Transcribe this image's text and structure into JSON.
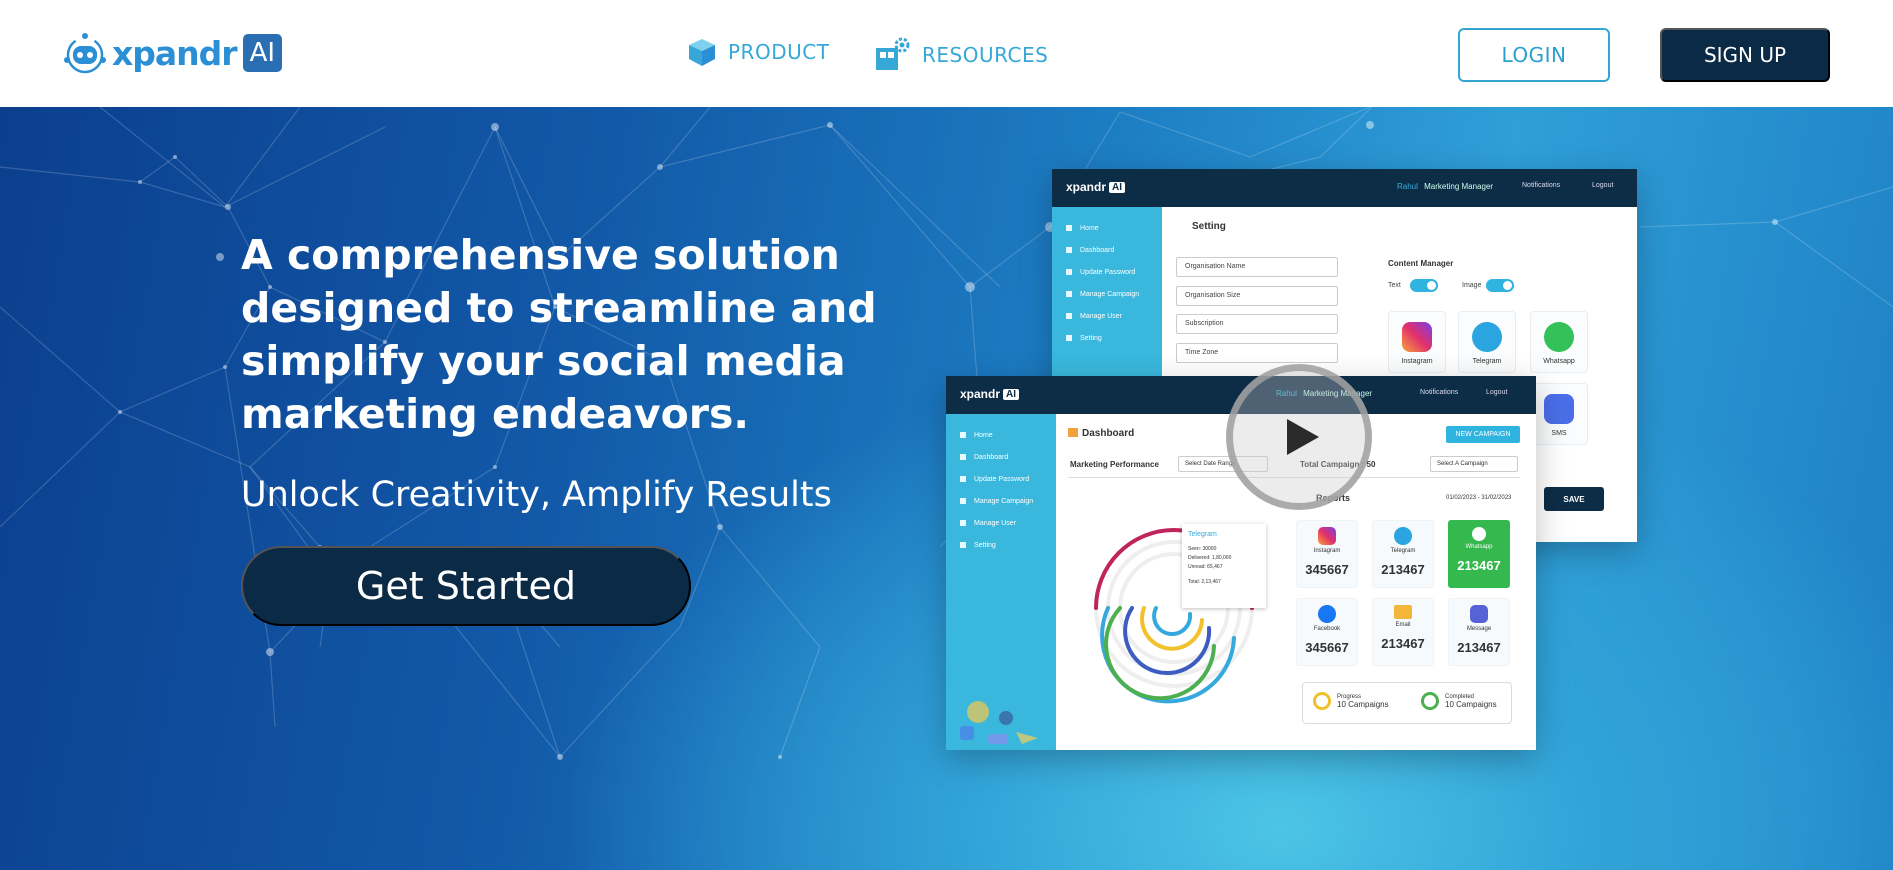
{
  "nav": {
    "brand": "xpandr",
    "brand_badge": "AI",
    "links": [
      {
        "label": "PRODUCT",
        "icon": "box-icon"
      },
      {
        "label": "RESOURCES",
        "icon": "resources-gear-icon"
      }
    ],
    "login_label": "LOGIN",
    "signup_label": "SIGN UP"
  },
  "hero": {
    "title": "A comprehensive solution designed to streamline and simplify your social media marketing endeavors.",
    "subtitle": "Unlock Creativity, Amplify Results",
    "cta_label": "Get Started"
  },
  "colors": {
    "brand_blue": "#2a8fd4",
    "navy": "#0b2a45",
    "accent_cyan": "#39b7dc",
    "whatsapp_green": "#35b84d"
  },
  "settings_mock": {
    "brand": "xpandr",
    "brand_badge": "AI",
    "user_name": "Rahul",
    "user_role": "Marketing Manager",
    "notifications_label": "Notifications",
    "logout_label": "Logout",
    "sidebar": [
      "Home",
      "Dashboard",
      "Update Password",
      "Manage Campaign",
      "Manage User",
      "Setting"
    ],
    "page_title": "Setting",
    "fields": [
      "Organisation Name",
      "Organisation Size",
      "Subscription",
      "Time Zone"
    ],
    "content_manager_title": "Content Manager",
    "toggles": [
      "Text",
      "Image"
    ],
    "apps": [
      "Instagram",
      "Telegram",
      "Whatsapp",
      "SMS"
    ],
    "save_label": "SAVE"
  },
  "dashboard_mock": {
    "brand": "xpandr",
    "brand_badge": "AI",
    "user_name": "Rahul",
    "user_role": "Marketing Manager",
    "notifications_label": "Notifications",
    "logout_label": "Logout",
    "sidebar": [
      "Home",
      "Dashboard",
      "Update Password",
      "Manage Campaign",
      "Manage User",
      "Setting"
    ],
    "page_title": "Dashboard",
    "new_campaign_label": "NEW CAMPAIGN",
    "marketing_performance_label": "Marketing Performance",
    "date_range_placeholder": "Select Date Range",
    "total_campaign_label": "Total Campaign : 50",
    "campaign_select_placeholder": "Select A Campaign",
    "reports_label": "Reports",
    "reports_date": "01/02/2023 - 31/02/2023",
    "tooltip": {
      "title": "Telegram",
      "lines": [
        "Seen: 30000",
        "Delivered: 1,80,000",
        "Unread: 65,467",
        "Total: 2,13,467"
      ]
    },
    "stats": [
      {
        "label": "Instagram",
        "value": "345667"
      },
      {
        "label": "Telegram",
        "value": "213467"
      },
      {
        "label": "Whatsapp",
        "value": "213467"
      },
      {
        "label": "Facebook",
        "value": "345667"
      },
      {
        "label": "Email",
        "value": "213467"
      },
      {
        "label": "Message",
        "value": "213467"
      }
    ],
    "progress": {
      "label": "Progress",
      "value": "10 Campaigns"
    },
    "completed": {
      "label": "Completed",
      "value": "10 Campaigns"
    }
  }
}
